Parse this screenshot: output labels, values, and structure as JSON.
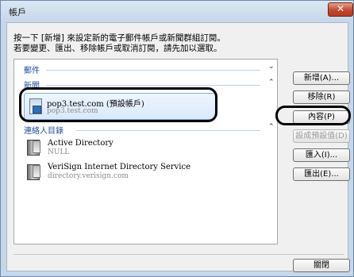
{
  "window": {
    "title": "帳戶",
    "close_icon": "✕"
  },
  "instructions": {
    "line1": "按一下 [新增] 來設定新的電子郵件帳戶或新聞群組訂閱。",
    "line2": "若要變更、匯出、移除帳戶或取消訂閱，請先加以選取。"
  },
  "groups": {
    "mail": {
      "label": "郵件",
      "chevron": "⌄"
    },
    "news": {
      "label": "新聞",
      "chevron": "⌃"
    },
    "directory": {
      "label": "連絡人目錄",
      "chevron": "⌃"
    }
  },
  "news_items": [
    {
      "name": "pop3.test.com (預設帳戶)",
      "sub": "pop3.test.com",
      "icon": "mail-server-icon"
    }
  ],
  "directory_items": [
    {
      "name": "Active Directory",
      "sub": "NULL",
      "icon": "server-icon"
    },
    {
      "name": "VeriSign Internet Directory Service",
      "sub": "directory.verisign.com",
      "icon": "server-icon"
    }
  ],
  "buttons": {
    "add": "新增(A)...",
    "remove": "移除(R)",
    "properties": "內容(P)",
    "set_default": "設成預設值(D)",
    "import": "匯入(I)...",
    "export": "匯出(E)...",
    "close": "關閉"
  }
}
